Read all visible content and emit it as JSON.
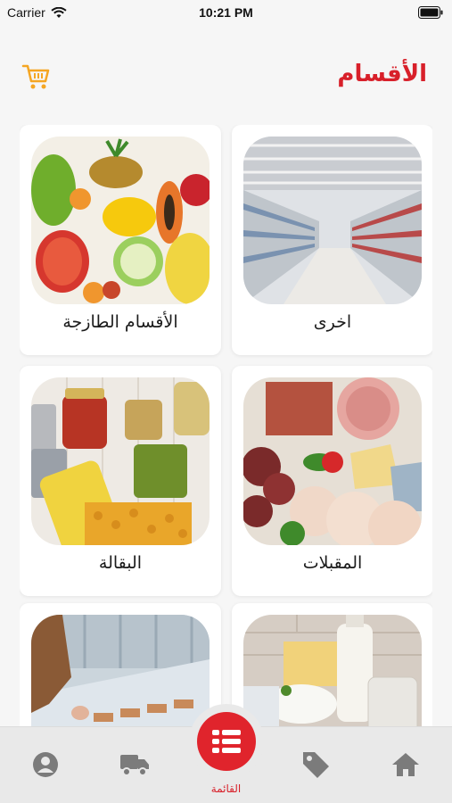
{
  "status_bar": {
    "carrier": "Carrier",
    "time": "10:21 PM"
  },
  "header": {
    "title": "الأقسام",
    "cart_icon": "cart-icon",
    "accent": "#f5a623",
    "title_color": "#d8202a"
  },
  "categories": [
    {
      "label": "اخرى",
      "image": "supermarket-aisle"
    },
    {
      "label": "الأقسام الطازجة",
      "image": "fresh-fruits"
    },
    {
      "label": "المقبلات",
      "image": "cold-cuts-and-cheese"
    },
    {
      "label": "البقالة",
      "image": "pantry-groceries"
    },
    {
      "label": "",
      "image": "dairy-products"
    },
    {
      "label": "",
      "image": "frozen-section"
    }
  ],
  "tabbar": {
    "active_label": "القائمة",
    "active_color": "#e0242c",
    "items": [
      "home-icon",
      "tag-icon",
      "menu-list-icon",
      "truck-icon",
      "user-icon"
    ]
  }
}
